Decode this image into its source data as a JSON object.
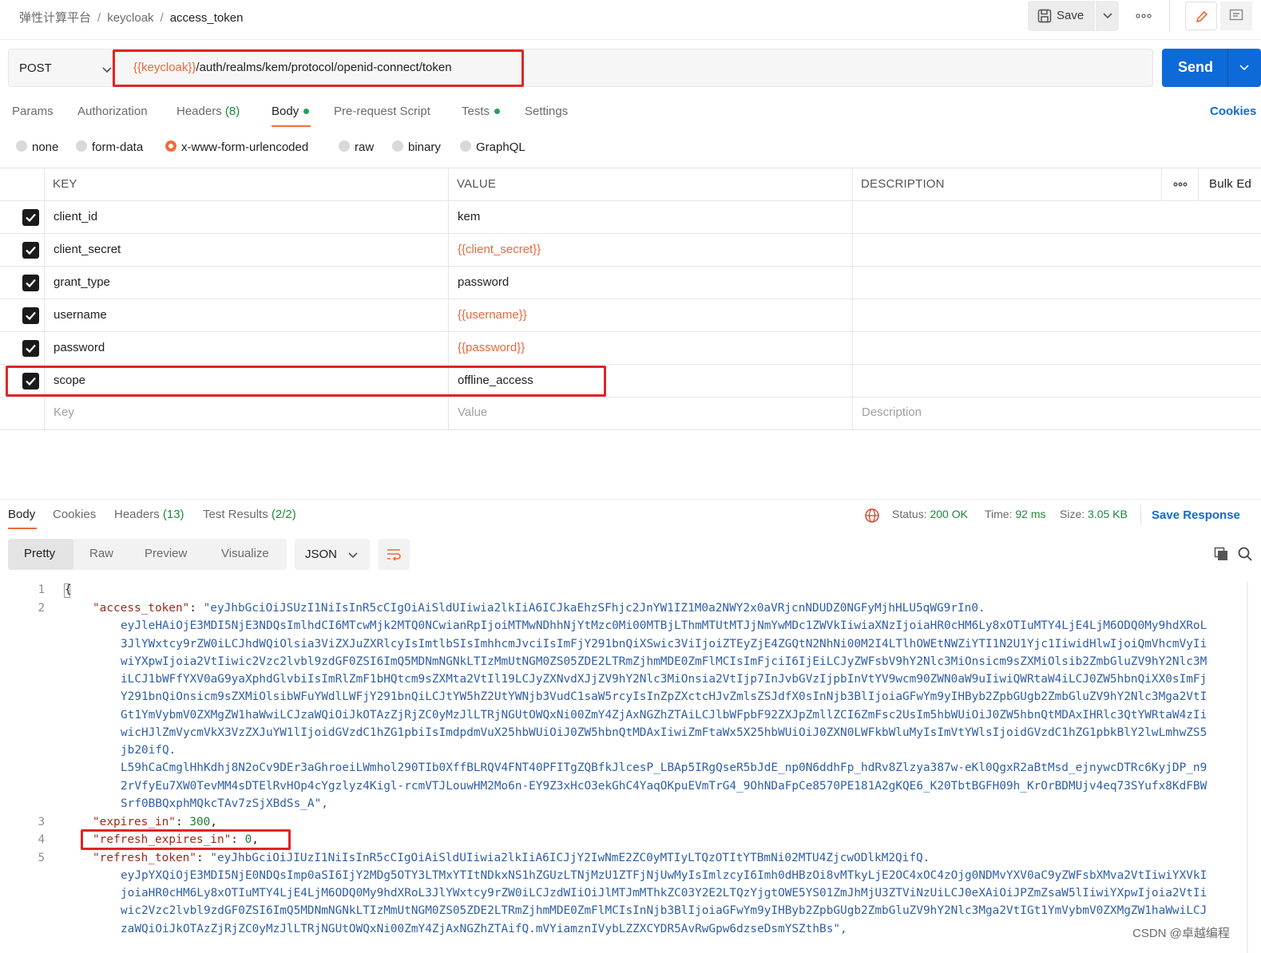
{
  "breadcrumb": {
    "workspace": "弹性计算平台",
    "collection": "keycloak",
    "request": "access_token",
    "sep": "/"
  },
  "toolbar": {
    "save_label": "Save"
  },
  "request": {
    "method": "POST",
    "url_variable": "{{keycloak}}",
    "url_path": "/auth/realms/kem/protocol/openid-connect/token",
    "send_label": "Send"
  },
  "tabs": {
    "params": "Params",
    "authorization": "Authorization",
    "headers": "Headers",
    "headers_count": "(8)",
    "body": "Body",
    "prerequest": "Pre-request Script",
    "tests": "Tests",
    "settings": "Settings",
    "cookies": "Cookies"
  },
  "body_types": {
    "none": "none",
    "form_data": "form-data",
    "urlencoded": "x-www-form-urlencoded",
    "raw": "raw",
    "binary": "binary",
    "graphql": "GraphQL"
  },
  "params_table": {
    "headers": {
      "key": "KEY",
      "value": "VALUE",
      "description": "DESCRIPTION",
      "bulk_edit": "Bulk Ed"
    },
    "rows": [
      {
        "key": "client_id",
        "value": "kem"
      },
      {
        "key": "client_secret",
        "value": "{{client_secret}}"
      },
      {
        "key": "grant_type",
        "value": "password"
      },
      {
        "key": "username",
        "value": "{{username}}"
      },
      {
        "key": "password",
        "value": "{{password}}"
      },
      {
        "key": "scope",
        "value": "offline_access"
      }
    ],
    "placeholders": {
      "key": "Key",
      "value": "Value",
      "description": "Description"
    }
  },
  "response": {
    "tabs": {
      "body": "Body",
      "cookies": "Cookies",
      "headers": "Headers",
      "headers_count": "(13)",
      "tests": "Test Results",
      "tests_count": "(2/2)"
    },
    "status_label": "Status:",
    "status_value": "200 OK",
    "time_label": "Time:",
    "time_value": "92 ms",
    "size_label": "Size:",
    "size_value": "3.05 KB",
    "save_response": "Save Response",
    "views": {
      "pretty": "Pretty",
      "raw": "Raw",
      "preview": "Preview",
      "visualize": "Visualize"
    },
    "format": "JSON"
  },
  "code": {
    "line_numbers": [
      "1",
      "2",
      "3",
      "4",
      "5"
    ],
    "open_brace": "{",
    "access_token_key": "\"access_token\"",
    "access_token_first": "\"eyJhbGciOiJSUzI1NiIsInR5cCIgOiAiSldUIiwia2lkIiA6ICJkaEhzSFhjc2JnYW1IZ1M0a2NWY2x0aVRjcnNDUDZ0NGFyMjhHLU5qWG9rIn0.",
    "access_token_cont": [
      "eyJleHAiOjE3MDI5NjE3NDQsImlhdCI6MTcwMjk2MTQ0NCwianRpIjoiMTMwNDhhNjYtMzc0Mi00MTBjLThmMTUtMTJjNmYwMDc1ZWVkIiwiaXNzIjoiaHR0cHM6Ly8xOTIuMTY4LjE4LjM6ODQ0My9hdXRoL",
      "3JlYWxtcy9rZW0iLCJhdWQiOlsia3ViZXJuZXRlcyIsImtlbSIsImhhcmJvciIsImFjY291bnQiXSwic3ViIjoiZTEyZjE4ZGQtN2NhNi00M2I4LTlhOWEtNWZiYTI1N2U1Yjc1IiwidHlwIjoiQmVhcmVyIi",
      "wiYXpwIjoia2VtIiwic2Vzc2lvbl9zdGF0ZSI6ImQ5MDNmNGNkLTIzMmUtNGM0ZS05ZDE2LTRmZjhmMDE0ZmFlMCIsImFjciI6IjEiLCJyZWFsbV9hY2Nlc3MiOnsicm9sZXMiOlsib2ZmbGluZV9hY2Nlc3M",
      "iLCJ1bWFfYXV0aG9yaXphdGlvbiIsImRlZmF1bHQtcm9sZXMta2VtIl19LCJyZXNvdXJjZV9hY2Nlc3MiOnsia2VtIjp7InJvbGVzIjpbInVtYV9wcm90ZWN0aW9uIiwiQWRtaW4iLCJ0ZW5hbnQiXX0sImFj",
      "Y291bnQiOnsicm9sZXMiOlsibWFuYWdlLWFjY291bnQiLCJtYW5hZ2UtYWNjb3VudC1saW5rcyIsInZpZXctcHJvZmlsZSJdfX0sInNjb3BlIjoiaGFwYm9yIHByb2ZpbGUgb2ZmbGluZV9hY2Nlc3Mga2VtI",
      "Gt1YmVybmV0ZXMgZW1haWwiLCJzaWQiOiJkOTAzZjRjZC0yMzJlLTRjNGUtOWQxNi00ZmY4ZjAxNGZhZTAiLCJlbWFpbF92ZXJpZmllZCI6ZmFsc2UsIm5hbWUiOiJ0ZW5hbnQtMDAxIHRlc3QtYWRtaW4zIi",
      "wicHJlZmVycmVkX3VzZXJuYW1lIjoidGVzdC1hZG1pbiIsImdpdmVuX25hbWUiOiJ0ZW5hbnQtMDAxIiwiZmFtaWx5X25hbWUiOiJ0ZXN0LWFkbWluMyIsImVtYWlsIjoidGVzdC1hZG1pbkBlY2lwLmhwZS5",
      "jb20ifQ.",
      "L59hCaCmglHhKdhj8N2oCv9DEr3aGhroeiLWmhol290TIb0XffBLRQV4FNT40PFITgZQBfkJlcesP_LBAp5IRgQseR5bJdE_np0N6ddhFp_hdRv8Zlzya387w-eKl0QgxR2aBtMsd_ejnywcDTRc6KyjDP_n9",
      "2rVfyEu7XW0TevMM4sDTElRvHOp4cYgzlyz4Kigl-rcmVTJLouwHM2Mo6n-EY9Z3xHcO3ekGhC4YaqOKpuEVmTrG4_9OhNDaFpCe8570PE181A2gKQE6_K20TbtBGFH09h_KrOrBDMUjv4eq73SYufx8KdFBW",
      "Srf0BBQxphMQkcTAv7zSjXBdSs_A\","
    ],
    "expires_in_key": "\"expires_in\"",
    "expires_in_value": "300",
    "refresh_expires_in_key": "\"refresh_expires_in\"",
    "refresh_expires_in_value": "0",
    "refresh_token_key": "\"refresh_token\"",
    "refresh_token_first": "\"eyJhbGciOiJIUzI1NiIsInR5cCIgOiAiSldUIiwia2lkIiA6ICJjY2IwNmE2ZC0yMTIyLTQzOTItYTBmNi02MTU4ZjcwODlkM2QifQ.",
    "refresh_token_cont": [
      "eyJpYXQiOjE3MDI5NjE0NDQsImp0aSI6IjY2MDg5OTY3LTMxYTItNDkxNS1hZGUzLTNjMzU1ZTFjNjUwMyIsImlzcyI6Imh0dHBzOi8vMTkyLjE2OC4xOC4zOjg0NDMvYXV0aC9yZWFsbXMva2VtIiwiYXVkI",
      "joiaHR0cHM6Ly8xOTIuMTY4LjE4LjM6ODQ0My9hdXRoL3JlYWxtcy9rZW0iLCJzdWIiOiJlMTJmMThkZC03Y2E2LTQzYjgtOWE5YS01ZmJhMjU3ZTViNzUiLCJ0eXAiOiJPZmZsaW5lIiwiYXpwIjoia2VtIi",
      "wic2Vzc2lvbl9zdGF0ZSI6ImQ5MDNmNGNkLTIzMmUtNGM0ZS05ZDE2LTRmZjhmMDE0ZmFlMCIsInNjb3BlIjoiaGFwYm9yIHByb2ZpbGUgb2ZmbGluZV9hY2Nlc3Mga2VtIGt1YmVybmV0ZXMgZW1haWwiLCJ",
      "zaWQiOiJkOTAzZjRjZC0yMzJlLTRjNGUtOWQxNi00ZmY4ZjAxNGZhZTAifQ.mVYiamznIVybLZZXCYDR5AvRwGpw6dzseDsmYSZthBs\","
    ],
    "colon": ": ",
    "comma": ","
  },
  "watermark": "CSDN @卓越编程",
  "colors": {
    "accent_orange": "#f26b3a",
    "send_blue": "#0e6ad8",
    "highlight_red": "#e02424",
    "status_green": "#1b8a3a"
  }
}
